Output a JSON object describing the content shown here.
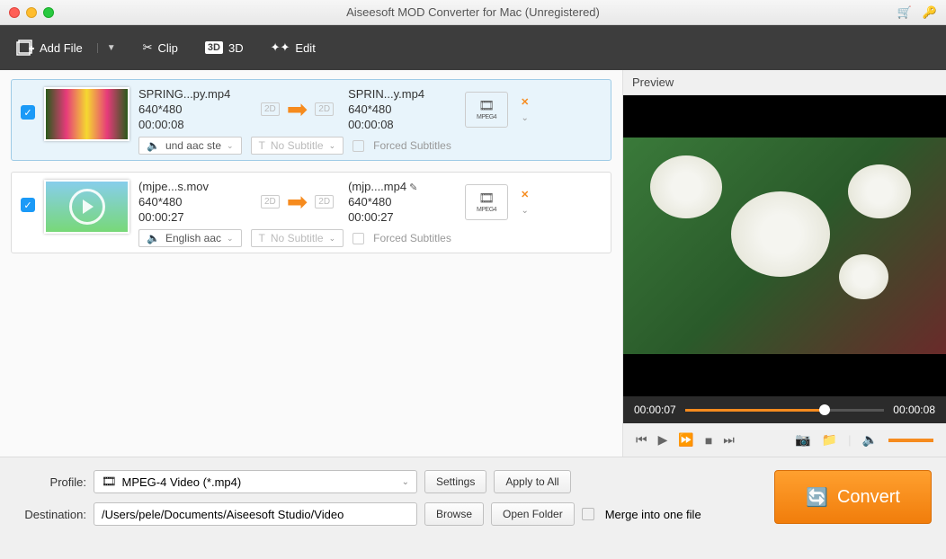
{
  "window": {
    "title": "Aiseesoft MOD Converter for Mac (Unregistered)"
  },
  "toolbar": {
    "add_file": "Add File",
    "clip": "Clip",
    "three_d": "3D",
    "edit": "Edit"
  },
  "files": [
    {
      "source_name": "SPRING...py.mp4",
      "source_res": "640*480",
      "source_dur": "00:00:08",
      "target_name": "SPRIN...y.mp4",
      "target_res": "640*480",
      "target_dur": "00:00:08",
      "audio_track": "und aac ste",
      "subtitle": "No Subtitle",
      "forced_label": "Forced Subtitles"
    },
    {
      "source_name": "(mjpe...s.mov",
      "source_res": "640*480",
      "source_dur": "00:00:27",
      "target_name": "(mjp....mp4",
      "target_res": "640*480",
      "target_dur": "00:00:27",
      "audio_track": "English aac",
      "subtitle": "No Subtitle",
      "forced_label": "Forced Subtitles"
    }
  ],
  "preview": {
    "label": "Preview",
    "current_time": "00:00:07",
    "total_time": "00:00:08"
  },
  "bottom": {
    "profile_label": "Profile:",
    "profile_value": "MPEG-4 Video (*.mp4)",
    "settings": "Settings",
    "apply_all": "Apply to All",
    "destination_label": "Destination:",
    "destination_value": "/Users/pele/Documents/Aiseesoft Studio/Video",
    "browse": "Browse",
    "open_folder": "Open Folder",
    "merge": "Merge into one file",
    "convert": "Convert"
  },
  "badges": {
    "two_d": "2D"
  }
}
